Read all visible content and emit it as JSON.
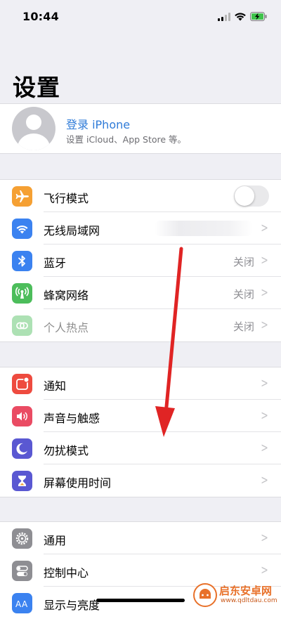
{
  "status": {
    "time": "10:44"
  },
  "title": "设置",
  "profile": {
    "name": "登录 iPhone",
    "subtitle": "设置 iCloud、App Store 等。"
  },
  "groups": [
    {
      "items": [
        {
          "label": "飞行模式",
          "icon": "airplane-icon",
          "color": "#f5a033",
          "control": "toggle",
          "toggle_on": false
        },
        {
          "label": "无线局域网",
          "icon": "wifi-icon",
          "color": "#3b82f0",
          "value": ""
        },
        {
          "label": "蓝牙",
          "icon": "bluetooth-icon",
          "color": "#3b82f0",
          "value": "关闭"
        },
        {
          "label": "蜂窝网络",
          "icon": "cellular-antenna-icon",
          "color": "#4cbd5b",
          "value": "关闭"
        },
        {
          "label": "个人热点",
          "icon": "hotspot-link-icon",
          "color": "#4cbd5b",
          "value": "关闭",
          "disabled": true
        }
      ]
    },
    {
      "items": [
        {
          "label": "通知",
          "icon": "notification-icon",
          "color": "#ee4b3f"
        },
        {
          "label": "声音与触感",
          "icon": "speaker-icon",
          "color": "#ea4b63"
        },
        {
          "label": "勿扰模式",
          "icon": "moon-icon",
          "color": "#5a58d2"
        },
        {
          "label": "屏幕使用时间",
          "icon": "hourglass-icon",
          "color": "#5a58d2"
        }
      ]
    },
    {
      "items": [
        {
          "label": "通用",
          "icon": "gear-icon",
          "color": "#8e8e93"
        },
        {
          "label": "控制中心",
          "icon": "toggles-icon",
          "color": "#8e8e93"
        },
        {
          "label": "显示与亮度",
          "icon": "text-size-icon",
          "color": "#3b82f0"
        }
      ]
    }
  ],
  "watermark": {
    "title": "启东安卓网",
    "url": "www.qdltdau.com"
  },
  "annotation": {
    "type": "swipe-down-arrow",
    "color": "#e02424"
  }
}
